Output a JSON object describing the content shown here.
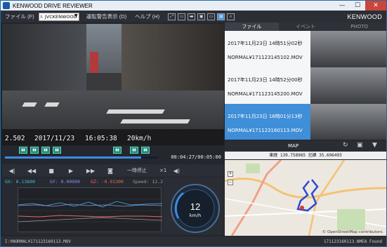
{
  "window": {
    "title": "KENWOOD DRIVE REVIEWER",
    "minimize": "—",
    "maximize": "☐",
    "close": "✕"
  },
  "menu": {
    "file": "ファイル (F)",
    "drive": "I: JVCKENWOOD",
    "warnings": "運転警告表示 (D)",
    "help": "ヘルプ (H)",
    "brand": "KENWOOD"
  },
  "video": {
    "osd_id": "2.502",
    "osd_date": "2017/11/23",
    "osd_time": "16:05:38",
    "osd_speed": "20km/h"
  },
  "timeline": {
    "position": "00:04:27/00:05:00",
    "progress": 0.89
  },
  "controls": {
    "pause_label": "一時停止",
    "rate": "×1"
  },
  "graph": {
    "gx": "GX: 0.13800",
    "gy": "GY: 0.00900",
    "gz": "GZ: -0.91300",
    "speed": "Speed: 12.2",
    "colors": {
      "gx": "#35c2e0",
      "gy": "#8a8ff0",
      "gz": "#e86a5a",
      "speed": "#9a9a9a"
    }
  },
  "gauge": {
    "value": "12",
    "unit": "km/h"
  },
  "tabs": [
    "ファイル",
    "イベント",
    "PHOTO"
  ],
  "files": [
    {
      "date": "2017年11月23日 14時51分02秒",
      "name": "NORMAL¥171123145102.MOV"
    },
    {
      "date": "2017年11月23日 14時52分00秒",
      "name": "NORMAL¥171123145200.MOV"
    },
    {
      "date": "2017年11月23日 16時01分13秒",
      "name": "NORMAL¥171123160113.MOV",
      "selected": true
    }
  ],
  "map": {
    "title": "MAP",
    "coords": "東経 139.758985  北緯 35.696493",
    "credit": "© OpenStreetMap contributors."
  },
  "status": {
    "left": "I:¥NORMAL¥171123160113.MOV",
    "right": "171123160113.NMEA Found"
  }
}
